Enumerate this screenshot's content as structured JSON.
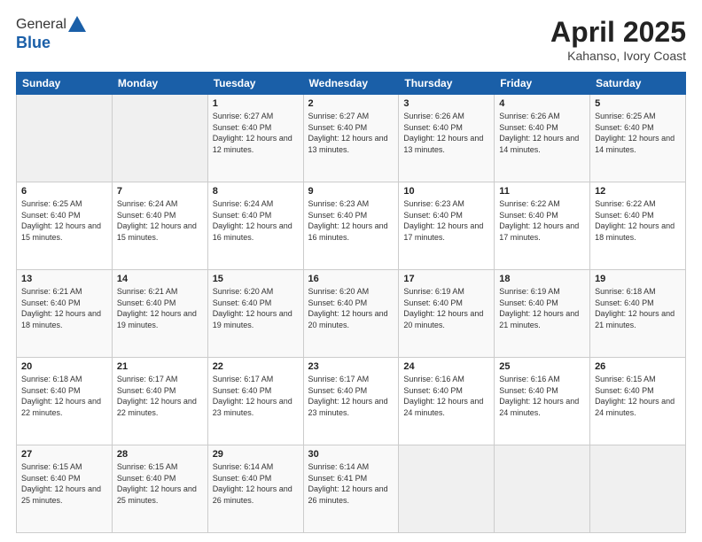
{
  "logo": {
    "general": "General",
    "blue": "Blue"
  },
  "title": {
    "main": "April 2025",
    "sub": "Kahanso, Ivory Coast"
  },
  "header_days": [
    "Sunday",
    "Monday",
    "Tuesday",
    "Wednesday",
    "Thursday",
    "Friday",
    "Saturday"
  ],
  "weeks": [
    [
      {
        "day": "",
        "info": ""
      },
      {
        "day": "",
        "info": ""
      },
      {
        "day": "1",
        "info": "Sunrise: 6:27 AM\nSunset: 6:40 PM\nDaylight: 12 hours and 12 minutes."
      },
      {
        "day": "2",
        "info": "Sunrise: 6:27 AM\nSunset: 6:40 PM\nDaylight: 12 hours and 13 minutes."
      },
      {
        "day": "3",
        "info": "Sunrise: 6:26 AM\nSunset: 6:40 PM\nDaylight: 12 hours and 13 minutes."
      },
      {
        "day": "4",
        "info": "Sunrise: 6:26 AM\nSunset: 6:40 PM\nDaylight: 12 hours and 14 minutes."
      },
      {
        "day": "5",
        "info": "Sunrise: 6:25 AM\nSunset: 6:40 PM\nDaylight: 12 hours and 14 minutes."
      }
    ],
    [
      {
        "day": "6",
        "info": "Sunrise: 6:25 AM\nSunset: 6:40 PM\nDaylight: 12 hours and 15 minutes."
      },
      {
        "day": "7",
        "info": "Sunrise: 6:24 AM\nSunset: 6:40 PM\nDaylight: 12 hours and 15 minutes."
      },
      {
        "day": "8",
        "info": "Sunrise: 6:24 AM\nSunset: 6:40 PM\nDaylight: 12 hours and 16 minutes."
      },
      {
        "day": "9",
        "info": "Sunrise: 6:23 AM\nSunset: 6:40 PM\nDaylight: 12 hours and 16 minutes."
      },
      {
        "day": "10",
        "info": "Sunrise: 6:23 AM\nSunset: 6:40 PM\nDaylight: 12 hours and 17 minutes."
      },
      {
        "day": "11",
        "info": "Sunrise: 6:22 AM\nSunset: 6:40 PM\nDaylight: 12 hours and 17 minutes."
      },
      {
        "day": "12",
        "info": "Sunrise: 6:22 AM\nSunset: 6:40 PM\nDaylight: 12 hours and 18 minutes."
      }
    ],
    [
      {
        "day": "13",
        "info": "Sunrise: 6:21 AM\nSunset: 6:40 PM\nDaylight: 12 hours and 18 minutes."
      },
      {
        "day": "14",
        "info": "Sunrise: 6:21 AM\nSunset: 6:40 PM\nDaylight: 12 hours and 19 minutes."
      },
      {
        "day": "15",
        "info": "Sunrise: 6:20 AM\nSunset: 6:40 PM\nDaylight: 12 hours and 19 minutes."
      },
      {
        "day": "16",
        "info": "Sunrise: 6:20 AM\nSunset: 6:40 PM\nDaylight: 12 hours and 20 minutes."
      },
      {
        "day": "17",
        "info": "Sunrise: 6:19 AM\nSunset: 6:40 PM\nDaylight: 12 hours and 20 minutes."
      },
      {
        "day": "18",
        "info": "Sunrise: 6:19 AM\nSunset: 6:40 PM\nDaylight: 12 hours and 21 minutes."
      },
      {
        "day": "19",
        "info": "Sunrise: 6:18 AM\nSunset: 6:40 PM\nDaylight: 12 hours and 21 minutes."
      }
    ],
    [
      {
        "day": "20",
        "info": "Sunrise: 6:18 AM\nSunset: 6:40 PM\nDaylight: 12 hours and 22 minutes."
      },
      {
        "day": "21",
        "info": "Sunrise: 6:17 AM\nSunset: 6:40 PM\nDaylight: 12 hours and 22 minutes."
      },
      {
        "day": "22",
        "info": "Sunrise: 6:17 AM\nSunset: 6:40 PM\nDaylight: 12 hours and 23 minutes."
      },
      {
        "day": "23",
        "info": "Sunrise: 6:17 AM\nSunset: 6:40 PM\nDaylight: 12 hours and 23 minutes."
      },
      {
        "day": "24",
        "info": "Sunrise: 6:16 AM\nSunset: 6:40 PM\nDaylight: 12 hours and 24 minutes."
      },
      {
        "day": "25",
        "info": "Sunrise: 6:16 AM\nSunset: 6:40 PM\nDaylight: 12 hours and 24 minutes."
      },
      {
        "day": "26",
        "info": "Sunrise: 6:15 AM\nSunset: 6:40 PM\nDaylight: 12 hours and 24 minutes."
      }
    ],
    [
      {
        "day": "27",
        "info": "Sunrise: 6:15 AM\nSunset: 6:40 PM\nDaylight: 12 hours and 25 minutes."
      },
      {
        "day": "28",
        "info": "Sunrise: 6:15 AM\nSunset: 6:40 PM\nDaylight: 12 hours and 25 minutes."
      },
      {
        "day": "29",
        "info": "Sunrise: 6:14 AM\nSunset: 6:40 PM\nDaylight: 12 hours and 26 minutes."
      },
      {
        "day": "30",
        "info": "Sunrise: 6:14 AM\nSunset: 6:41 PM\nDaylight: 12 hours and 26 minutes."
      },
      {
        "day": "",
        "info": ""
      },
      {
        "day": "",
        "info": ""
      },
      {
        "day": "",
        "info": ""
      }
    ]
  ]
}
